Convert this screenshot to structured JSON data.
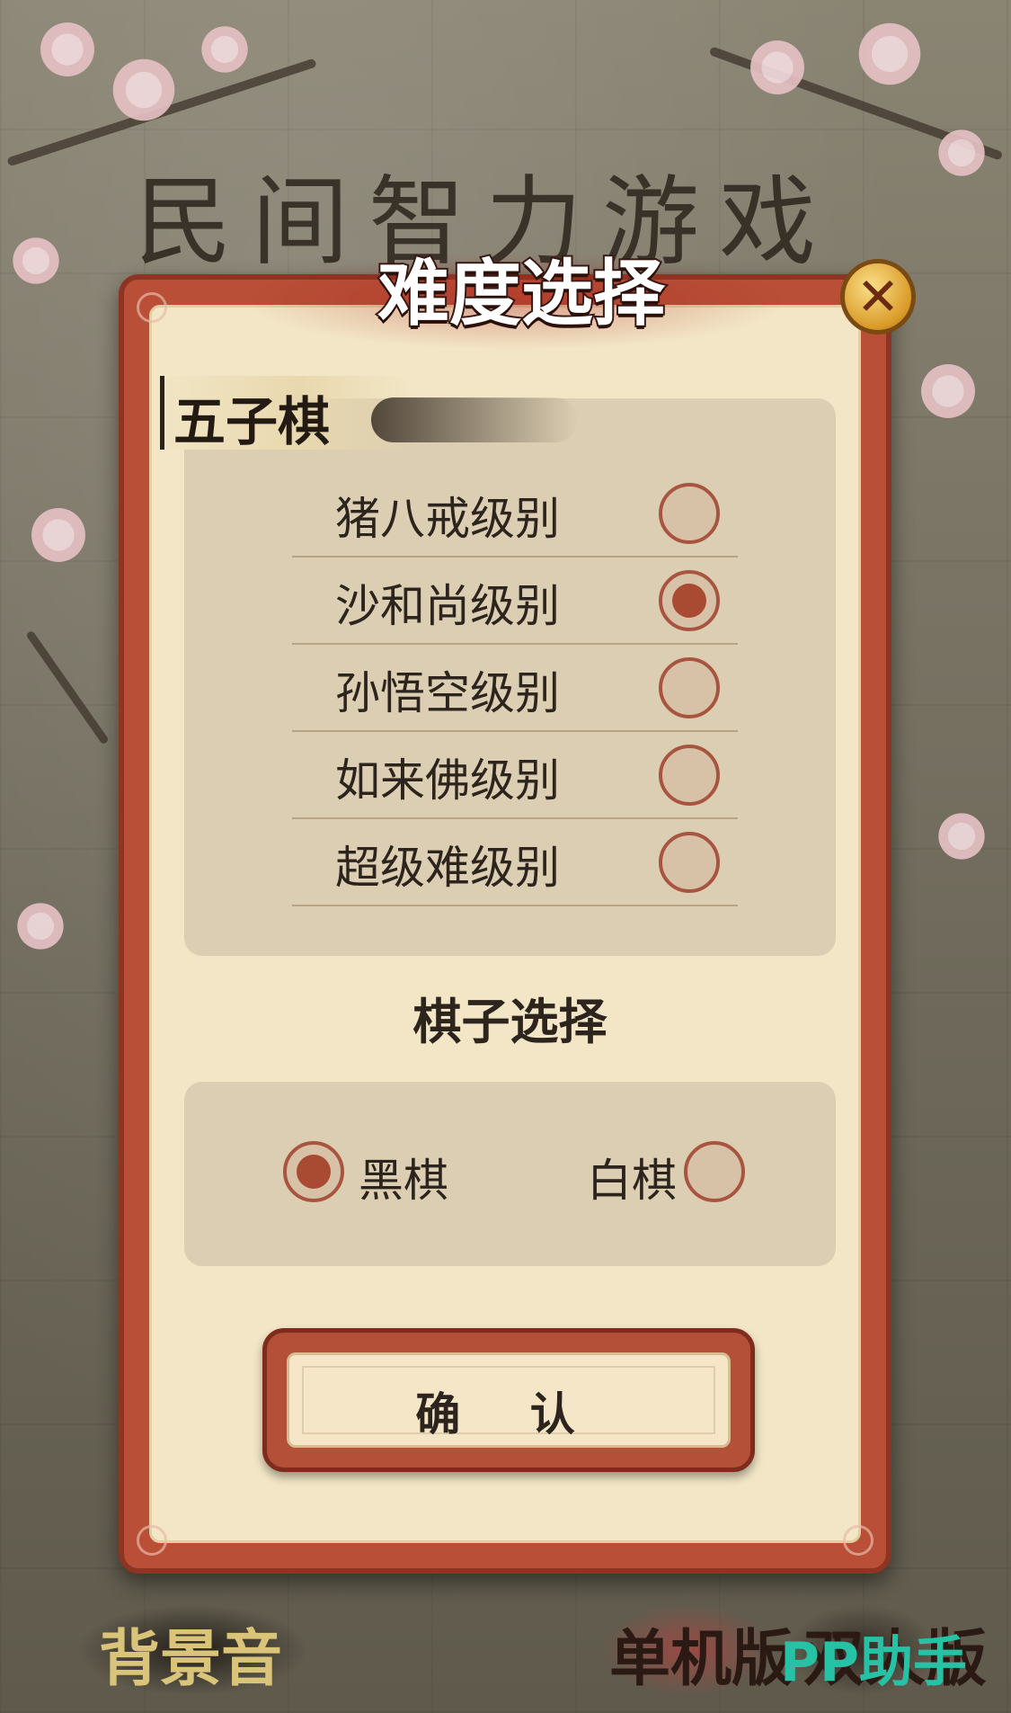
{
  "screen": {
    "title": "民间智力游戏"
  },
  "dialog": {
    "title": "难度选择",
    "close_icon": "close-icon",
    "game_name": "五子棋",
    "difficulty_options": [
      {
        "label": "猪八戒级别",
        "selected": false
      },
      {
        "label": "沙和尚级别",
        "selected": true
      },
      {
        "label": "孙悟空级别",
        "selected": false
      },
      {
        "label": "如来佛级别",
        "selected": false
      },
      {
        "label": "超级难级别",
        "selected": false
      }
    ],
    "piece_section_title": "棋子选择",
    "piece_options": [
      {
        "label": "黑棋",
        "selected": true
      },
      {
        "label": "白棋",
        "selected": false
      }
    ],
    "confirm_label": "确 认"
  },
  "bottom_bar": {
    "music_label": "背景音",
    "single_label": "单机版",
    "double_label": "双人版"
  },
  "watermark": "PP助手",
  "colors": {
    "accent": "#a94a33",
    "frame": "#b84f36",
    "panel": "#dcceb2",
    "paper": "#f2e6c6",
    "watermark": "#27c1a6"
  }
}
